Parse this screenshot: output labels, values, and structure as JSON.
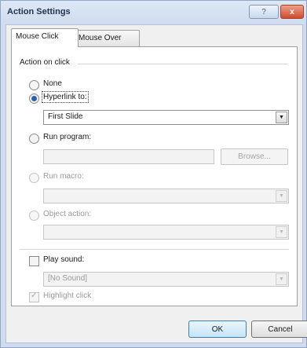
{
  "window": {
    "title": "Action Settings",
    "help_glyph": "?",
    "close_glyph": "x"
  },
  "tabs": [
    {
      "label": "Mouse Click",
      "active": true
    },
    {
      "label": "Mouse Over",
      "active": false
    }
  ],
  "group": {
    "label": "Action on click"
  },
  "options": {
    "none": {
      "label": "None",
      "selected": false,
      "enabled": true
    },
    "hyperlink": {
      "label": "Hyperlink to:",
      "selected": true,
      "enabled": true,
      "value": "First Slide"
    },
    "run_program": {
      "label": "Run program:",
      "selected": false,
      "enabled": true,
      "value": "",
      "browse_label": "Browse..."
    },
    "run_macro": {
      "label": "Run macro:",
      "selected": false,
      "enabled": false,
      "value": ""
    },
    "object_action": {
      "label": "Object action:",
      "selected": false,
      "enabled": false,
      "value": ""
    }
  },
  "play_sound": {
    "label": "Play sound:",
    "checked": false,
    "value": "[No Sound]"
  },
  "highlight_click": {
    "label": "Highlight click",
    "checked": true,
    "enabled": false
  },
  "buttons": {
    "ok": "OK",
    "cancel": "Cancel"
  },
  "icons": {
    "dropdown": "chevron-down-icon",
    "help": "help-icon",
    "close": "close-icon"
  },
  "colors": {
    "accent": "#2a62b0",
    "close_button": "#cf4a2c"
  }
}
